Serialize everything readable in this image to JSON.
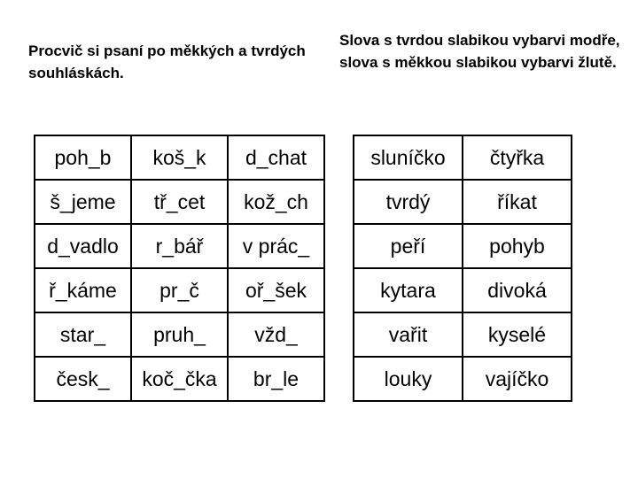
{
  "left_instruction": "Procvič si psaní po měkkých a tvrdých souhláskách.",
  "right_instruction": "Slova s tvrdou slabikou vybarvi modře, slova s měkkou slabikou vybarvi žlutě.",
  "left_table": {
    "rows": [
      [
        "poh_b",
        "koš_k",
        "d_chat"
      ],
      [
        "š_jeme",
        "tř_cet",
        "kož_ch"
      ],
      [
        "d_vadlo",
        "r_bář",
        "v prác_"
      ],
      [
        "ř_káme",
        "pr_č",
        "oř_šek"
      ],
      [
        "star_",
        "pruh_",
        "vžd_"
      ],
      [
        "česk_",
        "koč_čka",
        "br_le"
      ]
    ]
  },
  "right_table": {
    "rows": [
      [
        "sluníčko",
        "čtyřka"
      ],
      [
        "tvrdý",
        "říkat"
      ],
      [
        "peří",
        "pohyb"
      ],
      [
        "kytara",
        "divoká"
      ],
      [
        "vařit",
        "kyselé"
      ],
      [
        "louky",
        "vajíčko"
      ]
    ]
  }
}
